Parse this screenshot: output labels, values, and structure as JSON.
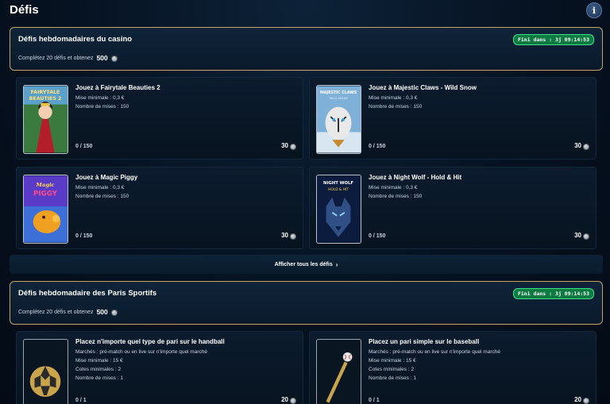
{
  "page": {
    "title": "Défis",
    "info_icon": "i"
  },
  "sections": [
    {
      "title": "Défis hebdomadaires du casino",
      "subtitle": "Complétez 20 défis et obtenez",
      "reward": "500",
      "timer": "Fini dans : 3j  09:14:53",
      "cards": [
        {
          "title": "Jouez à Fairytale Beauties 2",
          "lines": [
            "Mise minimale : 0,3  €",
            "Nombre de mises : 150"
          ],
          "progress": "0 / 150",
          "points": "30",
          "thumb_text": [
            "FAIRYTALE",
            "BEAUTIES 2"
          ]
        },
        {
          "title": "Jouez à Majestic Claws - Wild Snow",
          "lines": [
            "Mise minimale : 0,3  €",
            "Nombre de mises : 150"
          ],
          "progress": "0 / 150",
          "points": "30",
          "thumb_text": [
            "MAJESTIC CLAWS",
            "WILD SNOW"
          ]
        },
        {
          "title": "Jouez à Magic Piggy",
          "lines": [
            "Mise minimale : 0,3  €",
            "Nombre de mises : 150"
          ],
          "progress": "0 / 150",
          "points": "30",
          "thumb_text": [
            "Magic",
            "PIGGY"
          ]
        },
        {
          "title": "Jouez à Night Wolf - Hold & Hit",
          "lines": [
            "Mise minimale : 0,3  €",
            "Nombre de mises : 150"
          ],
          "progress": "0 / 150",
          "points": "30",
          "thumb_text": [
            "NIGHT WOLF",
            "HOLD & HIT"
          ]
        }
      ],
      "show_all": "Afficher tous les défis"
    },
    {
      "title": "Défis hebdomadaire des Paris Sportifs",
      "subtitle": "Complétez 20 défis et obtenez",
      "reward": "500",
      "timer": "Fini dans : 3j  09:14:53",
      "cards": [
        {
          "title": "Placez n'importe quel type de pari sur le handball",
          "lines": [
            "Marchés : pré-match ou en live sur n'importe quel marché",
            "Mise minimale : 15  €",
            "Cotes minimales : 2",
            "Nombre de mises : 1"
          ],
          "progress": "0 / 1",
          "points": "20"
        },
        {
          "title": "Placez un pari simple sur le baseball",
          "lines": [
            "Marchés : pré-match ou en live sur n'importe quel marché",
            "Mise minimale : 15  €",
            "Cotes minimales : 2",
            "Nombre de mises : 1"
          ],
          "progress": "0 / 1",
          "points": "20"
        }
      ]
    }
  ],
  "colors": {
    "gold_border": "#c0a46a",
    "timer_bg": "#0d7a42",
    "timer_border": "#3fe08a",
    "card_bg": "#0c1c2e"
  },
  "icons": {
    "info": "info-icon",
    "coin": "coin-icon",
    "chevron": "chevron-right-icon",
    "handball": "handball-icon",
    "baseball": "baseball-bat-icon"
  }
}
